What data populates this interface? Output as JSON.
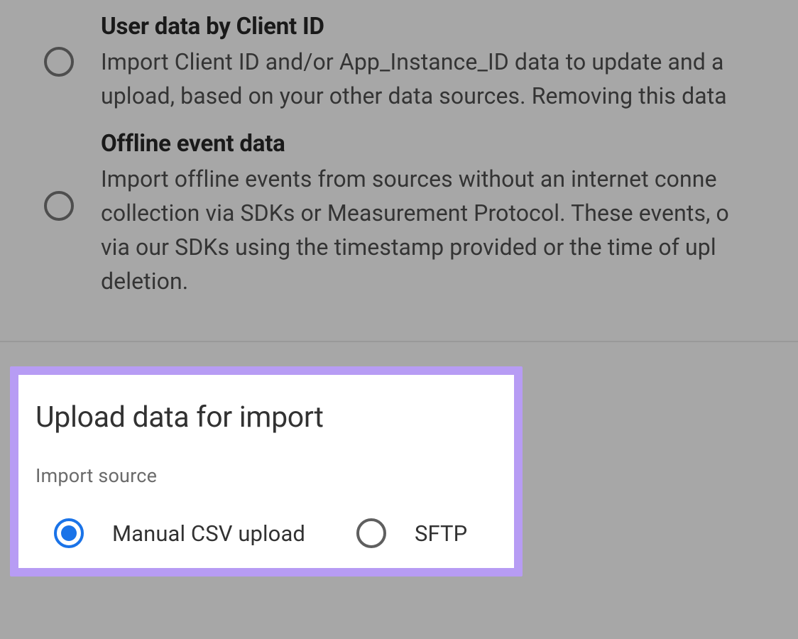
{
  "dataTypeOptions": [
    {
      "title": "User data by Client ID",
      "desc_lines": [
        "Import Client ID and/or App_Instance_ID data to update and a",
        "upload, based on your other data sources. Removing this data"
      ]
    },
    {
      "title": "Offline event data",
      "desc_lines": [
        "Import offline events from sources without an internet conne",
        "collection via SDKs or Measurement Protocol. These events, o",
        "via our SDKs using the timestamp provided or the time of upl",
        "deletion."
      ]
    }
  ],
  "uploadCard": {
    "title": "Upload data for import",
    "subtitle": "Import source",
    "options": [
      {
        "label": "Manual CSV upload",
        "selected": true
      },
      {
        "label": "SFTP",
        "selected": false
      }
    ]
  }
}
